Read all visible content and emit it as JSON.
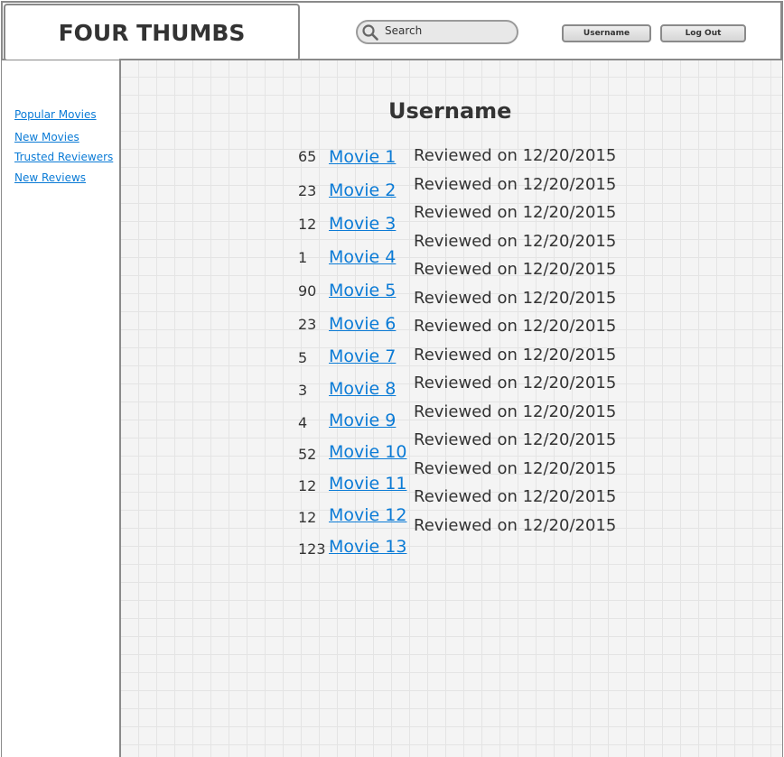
{
  "header": {
    "logo": "FOUR THUMBS",
    "search_placeholder": "Search",
    "username_button": "Username",
    "logout_button": "Log Out"
  },
  "sidebar": {
    "items": [
      {
        "label": "Popular Movies"
      },
      {
        "label": "New Movies"
      },
      {
        "label": "Trusted Reviewers"
      },
      {
        "label": "New Reviews"
      }
    ]
  },
  "main": {
    "title": "Username",
    "counts": [
      "65",
      "23",
      "12",
      "1",
      "90",
      "23",
      "5",
      "3",
      "4",
      "52",
      "12",
      "12",
      "123"
    ],
    "movies": [
      "Movie 1",
      "Movie 2",
      "Movie 3",
      "Movie 4",
      "Movie 5",
      "Movie 6",
      "Movie 7",
      "Movie 8",
      "Movie 9",
      "Movie 10",
      "Movie 11",
      "Movie 12",
      "Movie 13"
    ],
    "reviewed": [
      "Reviewed on 12/20/2015",
      "Reviewed on 12/20/2015",
      "Reviewed on 12/20/2015",
      "Reviewed on 12/20/2015",
      "Reviewed on 12/20/2015",
      "Reviewed on 12/20/2015",
      "Reviewed on 12/20/2015",
      "Reviewed on 12/20/2015",
      "Reviewed on 12/20/2015",
      "Reviewed on 12/20/2015",
      "Reviewed on 12/20/2015",
      "Reviewed on 12/20/2015",
      "Reviewed on 12/20/2015",
      "Reviewed on 12/20/2015"
    ]
  },
  "colors": {
    "link": "#0b7bd6",
    "text": "#333333",
    "border": "#8a8a8a",
    "grid_bg": "#f4f4f4"
  }
}
